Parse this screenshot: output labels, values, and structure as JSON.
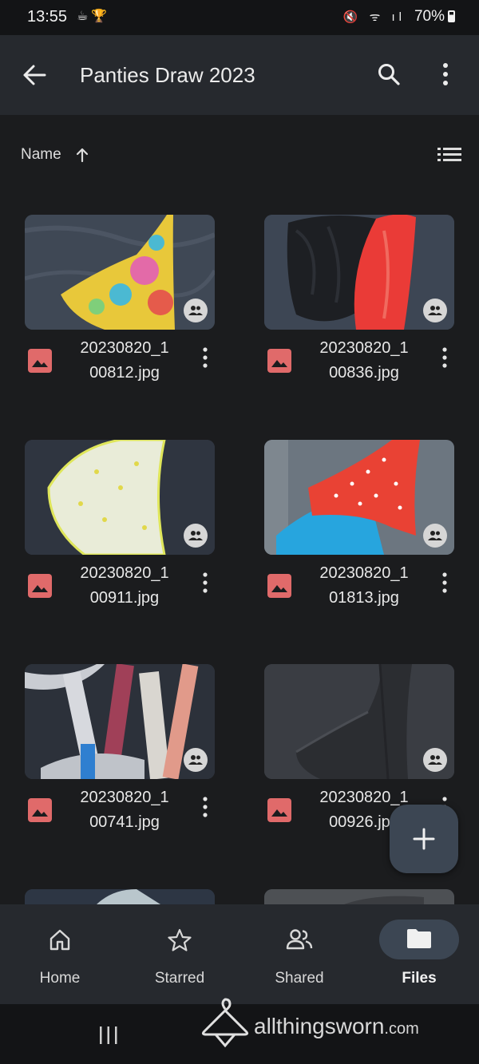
{
  "status": {
    "time": "13:55",
    "battery": "70%"
  },
  "appbar": {
    "title": "Panties Draw 2023"
  },
  "sort": {
    "label": "Name"
  },
  "files": [
    {
      "name_line1": "20230820_1",
      "name_line2": "00812.jpg"
    },
    {
      "name_line1": "20230820_1",
      "name_line2": "00836.jpg"
    },
    {
      "name_line1": "20230820_1",
      "name_line2": "00911.jpg"
    },
    {
      "name_line1": "20230820_1",
      "name_line2": "01813.jpg"
    },
    {
      "name_line1": "20230820_1",
      "name_line2": "00741.jpg"
    },
    {
      "name_line1": "20230820_1",
      "name_line2": "00926.jpg"
    }
  ],
  "nav": {
    "home": "Home",
    "starred": "Starred",
    "shared": "Shared",
    "files": "Files"
  },
  "watermark": {
    "brand": "allthingsworn",
    "tld": ".com"
  },
  "colors": {
    "accent_pill": "#3c4653",
    "file_icon": "#e06a6a",
    "appbar": "#26292e"
  }
}
